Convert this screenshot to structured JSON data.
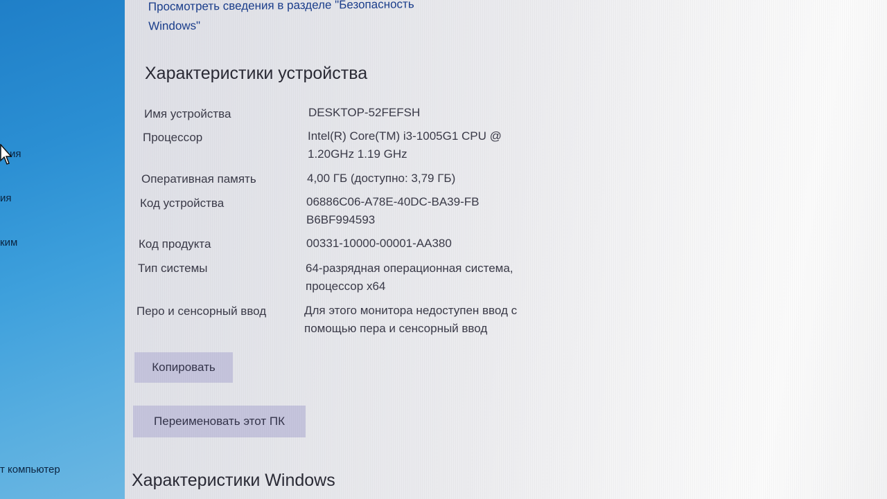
{
  "sidebar": {
    "items": [
      {
        "label": "ия"
      },
      {
        "label": "ия"
      },
      {
        "label": "ким"
      },
      {
        "label": "т компьютер"
      }
    ]
  },
  "security_link": "Просмотреть сведения в разделе \"Безопасность Windows\"",
  "device_specs": {
    "title": "Характеристики устройства",
    "rows": [
      {
        "label": "Имя устройства",
        "value": "DESKTOP-52FEFSH"
      },
      {
        "label": "Процессор",
        "value": "Intel(R) Core(TM) i3-1005G1 CPU @ 1.20GHz   1.19 GHz"
      },
      {
        "label": "Оперативная память",
        "value": "4,00 ГБ (доступно: 3,79 ГБ)"
      },
      {
        "label": "Код устройства",
        "value": "06886C06-A78E-40DC-BA39-FBB6BF994593"
      },
      {
        "label": "Код продукта",
        "value": "00331-10000-00001-AA380"
      },
      {
        "label": "Тип системы",
        "value": "64-разрядная операционная система, процессор x64"
      },
      {
        "label": "Перо и сенсорный ввод",
        "value": "Для этого монитора недоступен ввод с помощью пера и сенсорный ввод"
      }
    ]
  },
  "buttons": {
    "copy_label": "Копировать",
    "rename_label": "Переименовать этот ПК"
  },
  "windows_specs": {
    "title": "Характеристики Windows"
  },
  "colors": {
    "sidebar_blue": "#2b8fd3",
    "link_blue": "#1b3e8c",
    "button_bg": "#c5c4dc"
  }
}
